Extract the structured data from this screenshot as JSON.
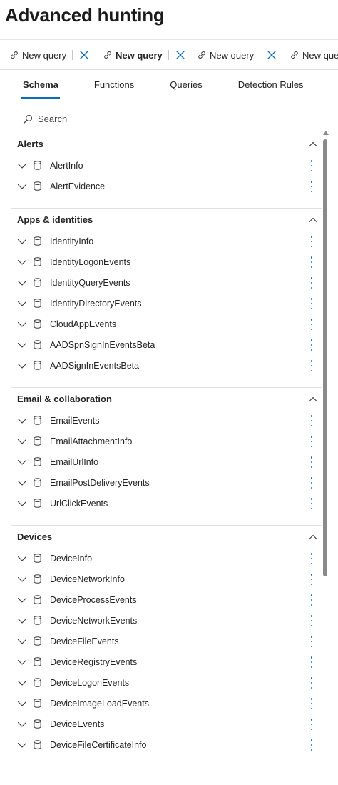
{
  "page": {
    "title": "Advanced hunting"
  },
  "query_tabs": [
    {
      "label": "New query",
      "active": false
    },
    {
      "label": "New query",
      "active": true
    },
    {
      "label": "New query",
      "active": false
    },
    {
      "label": "New que",
      "active": false
    }
  ],
  "sub_tabs": [
    {
      "label": "Schema",
      "active": true
    },
    {
      "label": "Functions",
      "active": false
    },
    {
      "label": "Queries",
      "active": false
    },
    {
      "label": "Detection Rules",
      "active": false
    }
  ],
  "search": {
    "placeholder": "Search",
    "value": ""
  },
  "sections": [
    {
      "title": "Alerts",
      "expanded": true,
      "tables": [
        "AlertInfo",
        "AlertEvidence"
      ]
    },
    {
      "title": "Apps & identities",
      "expanded": true,
      "tables": [
        "IdentityInfo",
        "IdentityLogonEvents",
        "IdentityQueryEvents",
        "IdentityDirectoryEvents",
        "CloudAppEvents",
        "AADSpnSignInEventsBeta",
        "AADSignInEventsBeta"
      ]
    },
    {
      "title": "Email & collaboration",
      "expanded": true,
      "tables": [
        "EmailEvents",
        "EmailAttachmentInfo",
        "EmailUrlInfo",
        "EmailPostDeliveryEvents",
        "UrlClickEvents"
      ]
    },
    {
      "title": "Devices",
      "expanded": true,
      "tables": [
        "DeviceInfo",
        "DeviceNetworkInfo",
        "DeviceProcessEvents",
        "DeviceNetworkEvents",
        "DeviceFileEvents",
        "DeviceRegistryEvents",
        "DeviceLogonEvents",
        "DeviceImageLoadEvents",
        "DeviceEvents",
        "DeviceFileCertificateInfo"
      ]
    }
  ],
  "colors": {
    "accent": "#0f6cbd",
    "text": "#242424",
    "divider": "#e0e0e0",
    "scrollbar": "#8a8a8a"
  },
  "icons": {
    "query_tab": "query-link-icon",
    "close": "close-icon",
    "search": "search-icon",
    "collapse": "chevron-up-icon",
    "expand_row": "chevron-down-icon",
    "table": "database-icon",
    "more": "more-vertical-icon"
  }
}
